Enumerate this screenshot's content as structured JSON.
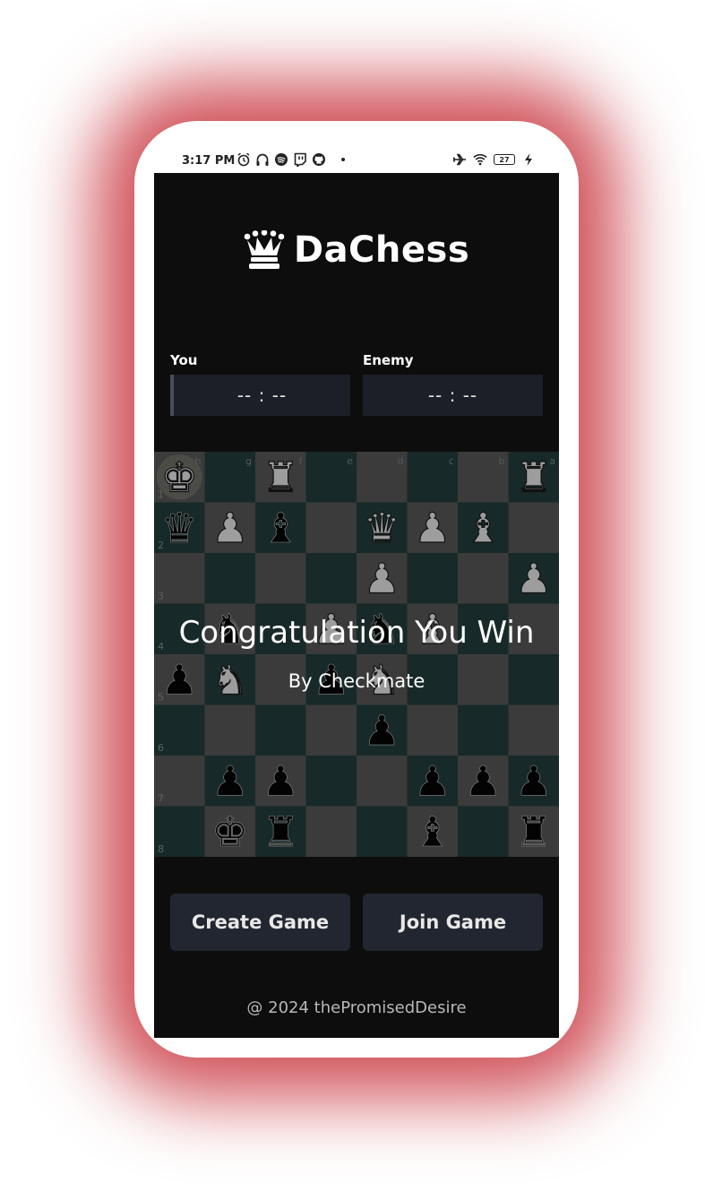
{
  "status_bar": {
    "time": "3:17 PM",
    "battery": "27",
    "left_icons": [
      "alarm-icon",
      "headphones-icon",
      "spotify-icon",
      "twitch-icon",
      "github-icon"
    ],
    "right_icons": [
      "airplane-icon",
      "wifi-icon",
      "battery-icon",
      "charging-icon"
    ]
  },
  "header": {
    "brand": "DaChess",
    "logo_icon": "queen-crown-icon"
  },
  "players": {
    "you_label": "You",
    "you_timer": "-- : --",
    "enemy_label": "Enemy",
    "enemy_timer": "-- : --"
  },
  "board": {
    "files": [
      "h",
      "g",
      "f",
      "e",
      "d",
      "c",
      "b",
      "a"
    ],
    "ranks": [
      "1",
      "2",
      "3",
      "4",
      "5",
      "6",
      "7",
      "8"
    ],
    "light_color": "#5b5b5b",
    "dark_color": "#244040",
    "position": [
      [
        "wK",
        "",
        "wR",
        "",
        "",
        "",
        "",
        "wR"
      ],
      [
        "bQ",
        "wP",
        "bB",
        "",
        "wQ",
        "wP",
        "wB",
        ""
      ],
      [
        "",
        "",
        "",
        "",
        "wP",
        "",
        "",
        "wP"
      ],
      [
        "",
        "bN",
        "",
        "wP",
        "bN",
        "wB",
        "",
        ""
      ],
      [
        "bP",
        "wN",
        "",
        "bP",
        "wN",
        "",
        "",
        ""
      ],
      [
        "",
        "",
        "",
        "",
        "bP",
        "",
        "",
        ""
      ],
      [
        "",
        "bP",
        "bP",
        "",
        "",
        "bP",
        "bP",
        "bP"
      ],
      [
        "",
        "bK",
        "bR",
        "",
        "",
        "bB",
        "",
        "bR"
      ]
    ]
  },
  "result": {
    "title": "Congratulation You Win",
    "subtitle": "By Checkmate"
  },
  "actions": {
    "create_label": "Create Game",
    "join_label": "Join Game"
  },
  "footer": {
    "text": "@ 2024 thePromisedDesire"
  }
}
